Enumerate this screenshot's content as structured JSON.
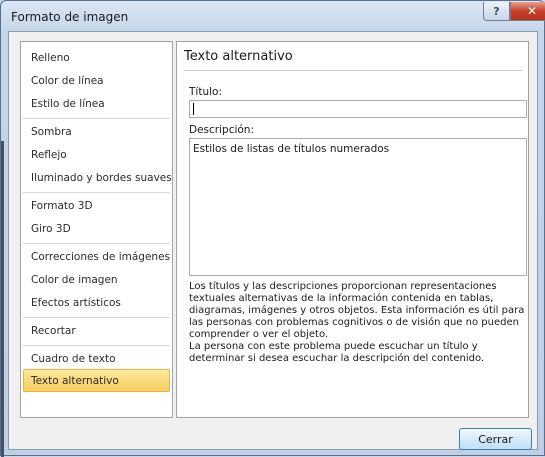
{
  "window": {
    "title": "Formato de imagen",
    "help_label": "?",
    "close_glyph": "✕"
  },
  "sidebar": {
    "items": [
      {
        "label": "Relleno"
      },
      {
        "label": "Color de línea"
      },
      {
        "label": "Estilo de línea"
      },
      {
        "label": "Sombra"
      },
      {
        "label": "Reflejo"
      },
      {
        "label": "Iluminado y bordes suaves"
      },
      {
        "label": "Formato 3D"
      },
      {
        "label": "Giro 3D"
      },
      {
        "label": "Correcciones de imágenes"
      },
      {
        "label": "Color de imagen"
      },
      {
        "label": "Efectos artísticos"
      },
      {
        "label": "Recortar"
      },
      {
        "label": "Cuadro de texto"
      },
      {
        "label": "Texto alternativo"
      }
    ],
    "selected_index": 13
  },
  "panel": {
    "title": "Texto alternativo",
    "title_field_label": "Título:",
    "title_field_value": "",
    "description_label": "Descripción:",
    "description_value": "Estilos de listas de títulos numerados",
    "help_paragraph_1": "Los títulos y las descripciones proporcionan representaciones textuales alternativas de la información contenida en tablas, diagramas, imágenes y otros objetos. Esta información es útil para las personas con problemas cognitivos o de visión que no pueden comprender o ver el objeto.",
    "help_paragraph_2": "La persona con este problema puede escuchar un título y determinar si desea escuchar la descripción del contenido."
  },
  "footer": {
    "close_label": "Cerrar"
  },
  "colors": {
    "selected_item": "#f8cd5e",
    "close_titlebar": "#c8412a",
    "dialog_bg": "#f0f0f0"
  }
}
